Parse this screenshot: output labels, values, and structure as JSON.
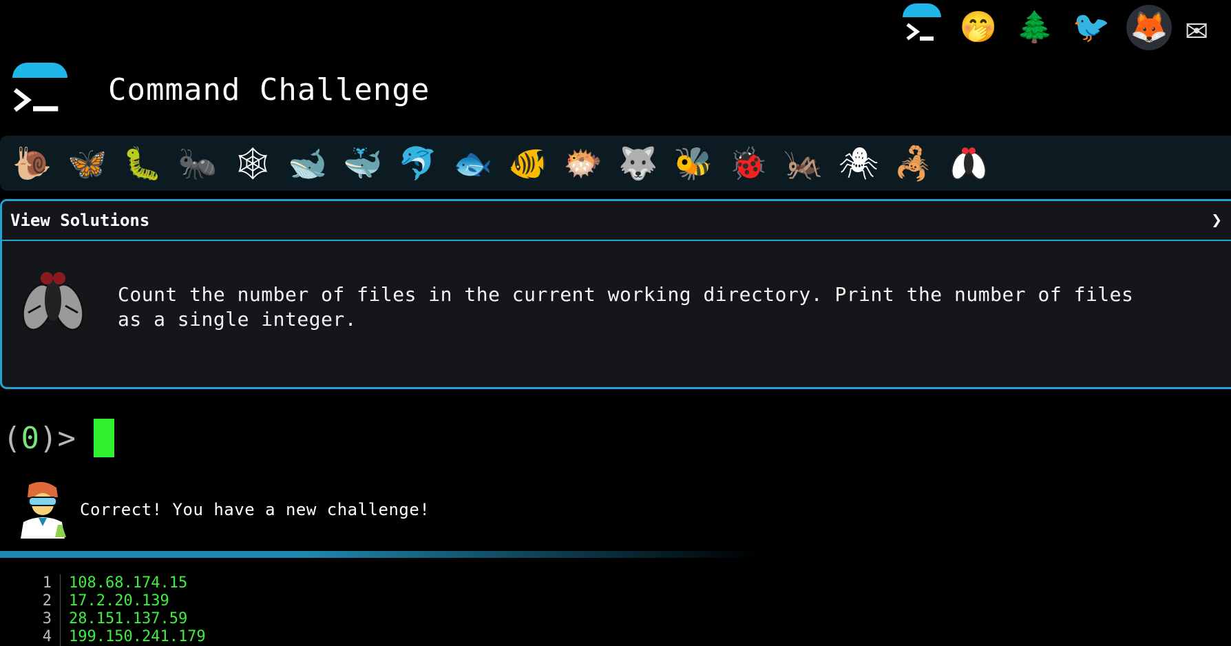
{
  "header": {
    "title": "Command Challenge"
  },
  "top_icons": [
    {
      "name": "command-challenge-icon"
    },
    {
      "name": "shush-face-icon",
      "glyph": "🤭"
    },
    {
      "name": "tree-icon",
      "glyph": "🌲"
    },
    {
      "name": "twitter-icon",
      "glyph": "🐦"
    },
    {
      "name": "gitlab-icon",
      "glyph": "🦊"
    },
    {
      "name": "mail-icon",
      "glyph": "✉"
    }
  ],
  "bugs": [
    {
      "name": "snail-icon",
      "glyph": "🐌"
    },
    {
      "name": "butterfly-icon",
      "glyph": "🦋"
    },
    {
      "name": "caterpillar-icon",
      "glyph": "🐛"
    },
    {
      "name": "ant-icon",
      "glyph": "🐜"
    },
    {
      "name": "spider-web-icon",
      "glyph": "🕸"
    },
    {
      "name": "whale-icon",
      "glyph": "🐋"
    },
    {
      "name": "spouting-whale-icon",
      "glyph": "🐳"
    },
    {
      "name": "dolphin-icon",
      "glyph": "🐬"
    },
    {
      "name": "fish-icon",
      "glyph": "🐟"
    },
    {
      "name": "tropical-fish-icon",
      "glyph": "🐠"
    },
    {
      "name": "blowfish-icon",
      "glyph": "🐡"
    },
    {
      "name": "wolf-icon",
      "glyph": "🐺"
    },
    {
      "name": "bee-icon",
      "glyph": "🐝"
    },
    {
      "name": "ladybug-icon",
      "glyph": "🐞"
    },
    {
      "name": "cricket-icon",
      "glyph": "🦗"
    },
    {
      "name": "spider-icon",
      "glyph": "🕷"
    },
    {
      "name": "scorpion-icon",
      "glyph": "🦂"
    },
    {
      "name": "fly-icon",
      "glyph": "🪰"
    }
  ],
  "panel": {
    "header_label": "View Solutions",
    "chevron": "❯",
    "challenge_text": "Count the number of files in the current working directory. Print the number of files as a single integer."
  },
  "prompt": {
    "open": "(",
    "count": "0",
    "close": ")",
    "arrow": ">",
    "input_value": ""
  },
  "feedback": {
    "text": "Correct! You have a new challenge!"
  },
  "output": {
    "rows": [
      {
        "num": "1",
        "value": "108.68.174.15"
      },
      {
        "num": "2",
        "value": "17.2.20.139"
      },
      {
        "num": "3",
        "value": "28.151.137.59"
      },
      {
        "num": "4",
        "value": "199.150.241.179"
      }
    ]
  },
  "colors": {
    "accent": "#21a3d4",
    "prompt_green": "#2ef02e",
    "background": "#000000",
    "panel_bg": "#141619"
  }
}
